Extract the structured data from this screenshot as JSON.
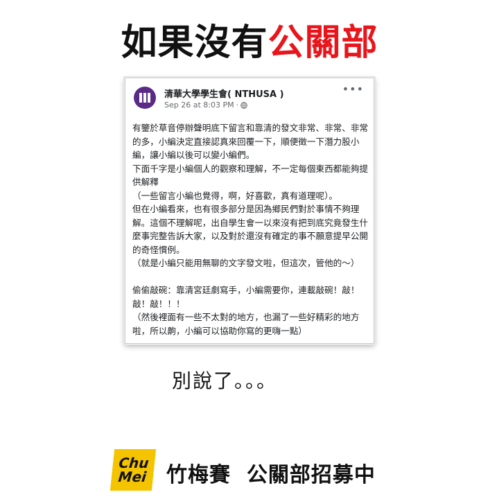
{
  "headline": {
    "part1": "如果沒有",
    "part2": "公關部"
  },
  "post": {
    "page_name": "清華大學學生會( NTHUSA )",
    "timestamp": "Sep 26 at 8:03 PM",
    "meta_separator": "·",
    "privacy_icon": "globe-icon",
    "more_icon": "more-options-icon",
    "paragraphs": [
      "有鑒於草音停辦聲明底下留言和靠清的發文非常、非常、非常的多，小編決定直接認真來回覆一下，順便徵一下潛力股小編，讓小編以後可以變小編們。",
      "下面千字是小編個人的觀察和理解，不一定每個東西都能夠提供解釋",
      "（一些留言小編也覺得，啊，好喜歡，真有道理呢）。",
      "但在小編看來，也有很多部分是因為鄉民們對於事情不夠理解。這個不理解呢，出自學生會一以來沒有把到底究竟發生什麼事完整告訴大家，以及對於還沒有確定的事不願意提早公開的奇怪慣例。",
      "（就是小編只能用無聊的文字發文啦，但這次，管他的～）",
      "",
      "偷偷敲碗：靠清宮廷劇寫手，小編需要你，連載敲碗！敲！敲！敲！！！",
      "（然後裡面有一些不太對的地方，也漏了一些好精彩的地方啦，所以齁，小編可以協助你寫的更嗨一點）"
    ]
  },
  "comment_text": "別說了。。。",
  "footer": {
    "logo_line1": "Chu",
    "logo_line2": "Mei",
    "text": "竹梅賽  公關部招募中"
  },
  "colors": {
    "headline_black": "#111111",
    "headline_red": "#e8161c",
    "avatar_purple": "#5b2a86",
    "logo_yellow": "#f5c400"
  }
}
